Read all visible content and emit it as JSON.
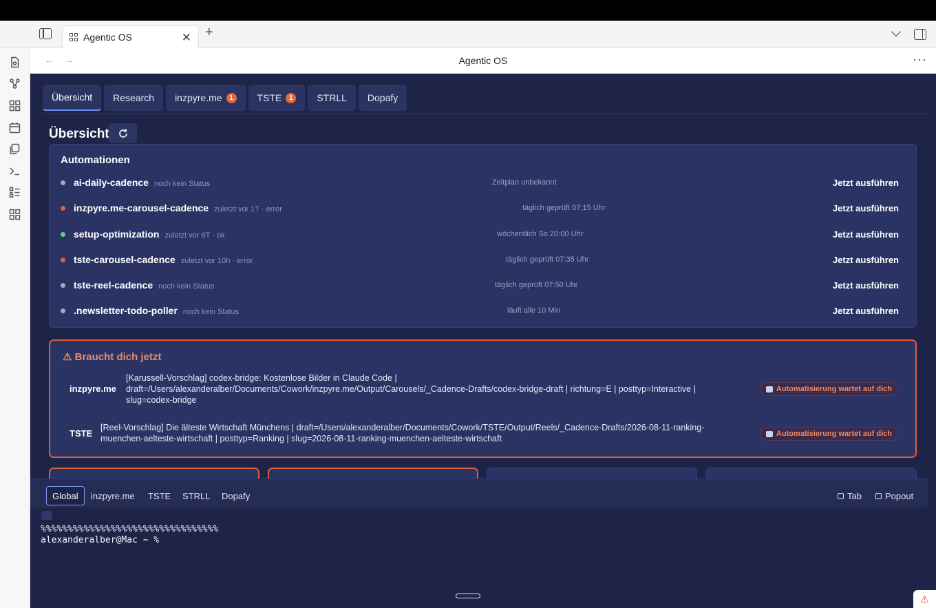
{
  "browser": {
    "tab_title": "Agentic OS",
    "tab_close": "✕",
    "new_tab": "+",
    "page_title": "Agentic OS",
    "back": "←",
    "forward": "→",
    "more": "···"
  },
  "app_tabs": [
    {
      "label": "Übersicht",
      "badge": ""
    },
    {
      "label": "Research",
      "badge": ""
    },
    {
      "label": "inzpyre.me",
      "badge": "1"
    },
    {
      "label": "TSTE",
      "badge": "1"
    },
    {
      "label": "STRLL",
      "badge": ""
    },
    {
      "label": "Dopafy",
      "badge": ""
    }
  ],
  "overview": {
    "title": "Übersicht"
  },
  "automations": {
    "title": "Automationen",
    "run_label": "Jetzt ausführen",
    "items": [
      {
        "name": "ai-daily-cadence",
        "status": "noch kein Status",
        "schedule": "Zeitplan unbekannt",
        "dot_color": "#a3a9cc"
      },
      {
        "name": "inzpyre.me-carousel-cadence",
        "status": "zuletzt vor 1T · error",
        "schedule": "täglich geprüft 07:15 Uhr",
        "dot_color": "#e0603a"
      },
      {
        "name": "setup-optimization",
        "status": "zuletzt vor 6T · ok",
        "schedule": "wöchentlich So 20:00 Uhr",
        "dot_color": "#5fcf7c"
      },
      {
        "name": "tste-carousel-cadence",
        "status": "zuletzt vor 10h · error",
        "schedule": "täglich geprüft 07:35 Uhr",
        "dot_color": "#e0603a"
      },
      {
        "name": "tste-reel-cadence",
        "status": "noch kein Status",
        "schedule": "täglich geprüft 07:50 Uhr",
        "dot_color": "#a3a9cc"
      },
      {
        "name": ".newsletter-todo-poller",
        "status": "noch kein Status",
        "schedule": "läuft alle 10 Min",
        "dot_color": "#a3a9cc"
      }
    ]
  },
  "alerts": {
    "title": "⚠ Braucht dich jetzt",
    "badge_label": "Automatisierung wartet auf dich",
    "items": [
      {
        "project": "inzpyre.me",
        "message": "[Karussell-Vorschlag] codex-bridge: Kostenlose Bilder in Claude Code | draft=/Users/alexanderalber/Documents/Cowork/inzpyre.me/Output/Carousels/_Cadence-Drafts/codex-bridge-draft | richtung=E | posttyp=Interactive | slug=codex-bridge"
      },
      {
        "project": "TSTE",
        "message": "[Reel-Vorschlag] Die älteste Wirtschaft Münchens | draft=/Users/alexanderalber/Documents/Cowork/TSTE/Output/Reels/_Cadence-Drafts/2026-08-11-ranking-muenchen-aelteste-wirtschaft | posttyp=Ranking | slug=2026-08-11-ranking-muenchen-aelteste-wirtschaft"
      }
    ]
  },
  "terminal_tabs": [
    "Global",
    "inzpyre.me",
    "TSTE",
    "STRLL",
    "Dopafy"
  ],
  "terminal_actions": {
    "tab": "Tab",
    "popout": "Popout"
  },
  "terminal": {
    "line1": "%%%%%%%%%%%%%%%%%%%%%%%%%%%%%%%%%",
    "prompt": "alexanderalber@Mac ~ % "
  }
}
